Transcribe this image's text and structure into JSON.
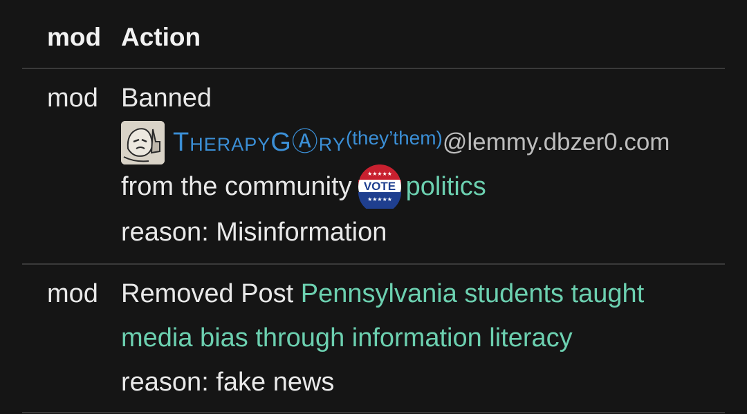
{
  "header": {
    "mod_col": "mod",
    "action_col": "Action"
  },
  "rows": [
    {
      "mod": "mod",
      "action": "Banned",
      "user": {
        "name": "TherapyGⒶry",
        "pronouns": "(they’them)",
        "instance": "@lemmy.dbzer0.com"
      },
      "from_prefix": "from the community",
      "community_icon_text": "VOTE",
      "community": "politics",
      "reason": "reason: Misinformation"
    },
    {
      "mod": "mod",
      "action": "Removed Post",
      "post_title_line1": "Pennsylvania students taught",
      "post_title_line2": "media bias through information literacy",
      "reason": "reason: fake news"
    }
  ],
  "colors": {
    "background": "#151515",
    "link": "#6cd0b0",
    "user": "#3b8fd6",
    "divider": "#3a3a3a"
  }
}
